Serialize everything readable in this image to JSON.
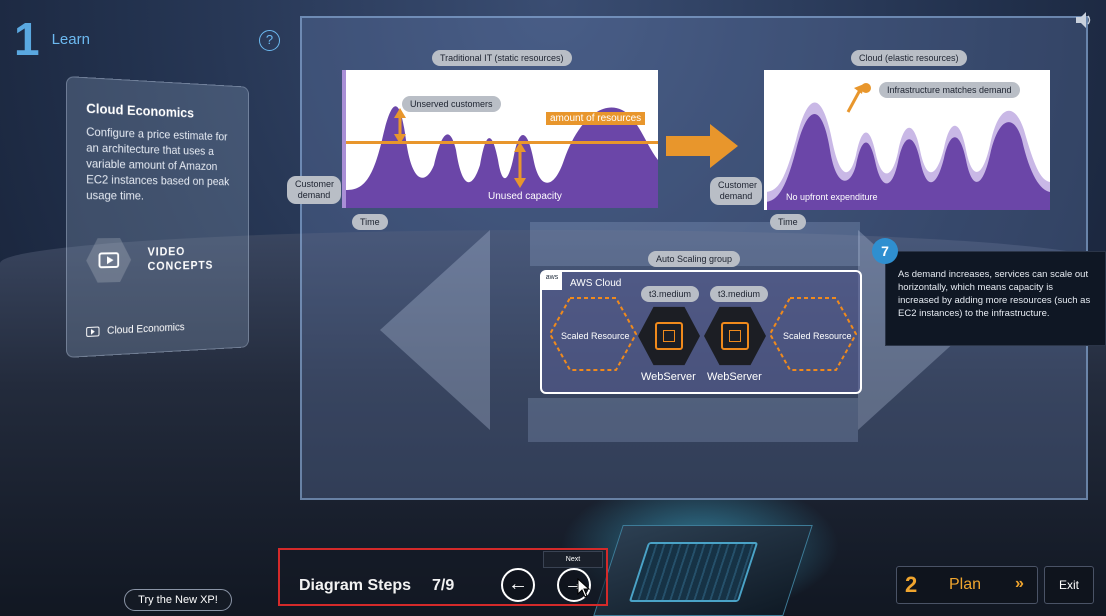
{
  "header": {
    "step_number": "1",
    "step_label": "Learn",
    "help": "?"
  },
  "card": {
    "title": "Cloud Economics",
    "description": "Configure a price estimate for an architecture that uses a variable amount of Amazon EC2 instances based on peak usage time.",
    "video_label_line1": "VIDEO",
    "video_label_line2": "CONCEPTS",
    "concept_item": "Cloud Economics"
  },
  "diagram": {
    "traditional_title": "Traditional IT (static resources)",
    "cloud_title": "Cloud (elastic resources)",
    "unserved": "Unserved customers",
    "amount_of_resources": "amount of resources",
    "unused_capacity": "Unused capacity",
    "customer_demand_left": "Customer demand",
    "customer_demand_right": "Customer demand",
    "time_left": "Time",
    "time_right": "Time",
    "infra_matches": "Infrastructure matches demand",
    "no_upfront": "No upfront expenditure",
    "asg_label": "Auto Scaling group",
    "aws_logo": "aws",
    "aws_cloud": "AWS Cloud",
    "scaled_left": "Scaled Resource",
    "scaled_right": "Scaled Resource",
    "instance_type_1": "t3.medium",
    "instance_type_2": "t3.medium",
    "server_1": "WebServer",
    "server_2": "WebServer"
  },
  "tooltip": {
    "step": "7",
    "text": "As demand increases, services can scale out horizontally, which means capacity is increased by adding more resources (such as EC2 instances) to the infrastructure."
  },
  "footer": {
    "try_new": "Try the New XP!",
    "diagram_steps": "Diagram Steps",
    "step_count": "7/9",
    "prev_glyph": "←",
    "next_glyph": "→",
    "next_tooltip": "Next",
    "plan_num": "2",
    "plan_label": "Plan",
    "plan_arrows": "»",
    "exit": "Exit"
  },
  "colors": {
    "accent_blue": "#6cb9f0",
    "orange": "#e8962c",
    "purple": "#6b46a8",
    "lavender": "#c9b8e6",
    "highlight_red": "#d42a2a"
  }
}
